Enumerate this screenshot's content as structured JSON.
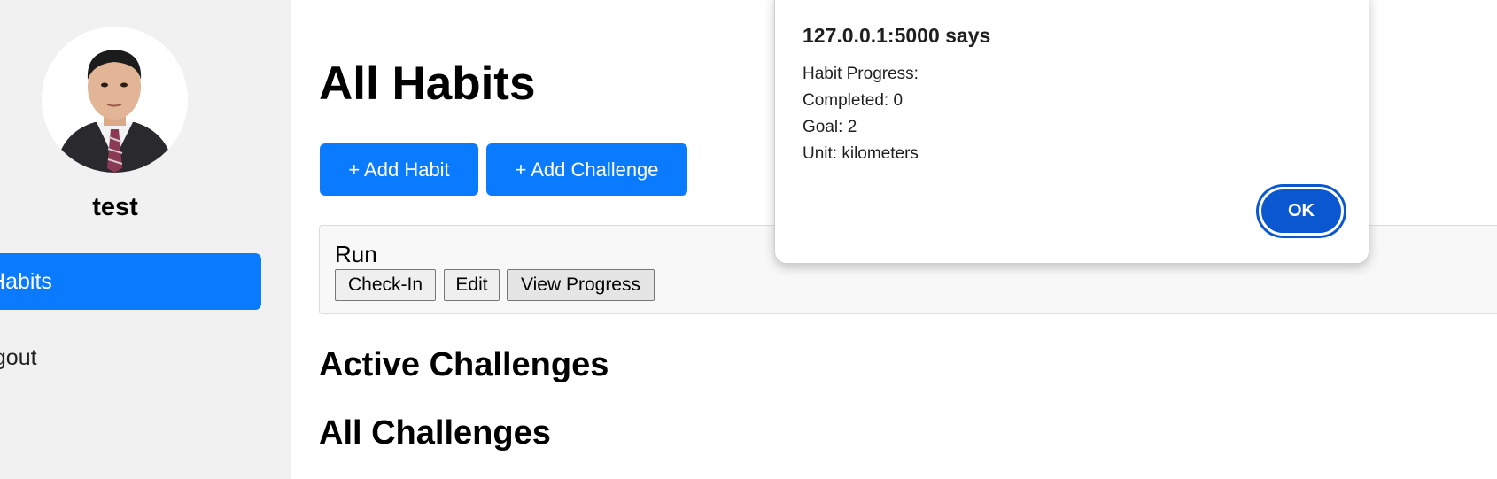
{
  "sidebar": {
    "username": "test",
    "nav_active_label": "ll Habits",
    "nav_logout_label": "ogout"
  },
  "main": {
    "page_title": "All Habits",
    "add_habit_label": "+ Add Habit",
    "add_challenge_label": "+ Add Challenge",
    "habits": [
      {
        "name": "Run",
        "checkin_label": "Check-In",
        "edit_label": "Edit",
        "view_progress_label": "View Progress"
      }
    ],
    "active_challenges_title": "Active Challenges",
    "all_challenges_title": "All Challenges"
  },
  "dialog": {
    "origin": "127.0.0.1:5000 says",
    "lines": [
      "Habit Progress:",
      "Completed: 0",
      "Goal: 2",
      "Unit: kilometers"
    ],
    "ok_label": "OK"
  },
  "colors": {
    "primary": "#0a7bff",
    "dialog_button": "#0b57d0",
    "sidebar_bg": "#f1f1f1"
  }
}
